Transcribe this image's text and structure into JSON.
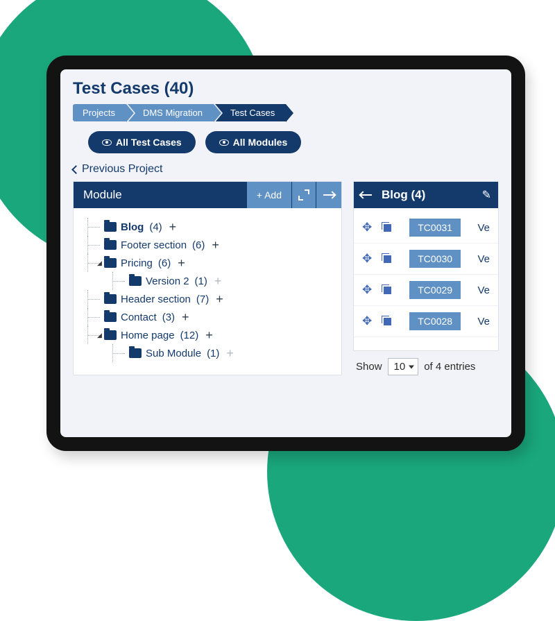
{
  "page": {
    "title": "Test Cases (40)"
  },
  "breadcrumb": {
    "items": [
      {
        "label": "Projects"
      },
      {
        "label": "DMS Migration"
      },
      {
        "label": "Test Cases"
      }
    ]
  },
  "pills": {
    "all_test_cases": "All Test Cases",
    "all_modules": "All Modules"
  },
  "nav": {
    "previous_project": "Previous Project"
  },
  "module_panel": {
    "title": "Module",
    "add_label": "+  Add",
    "tree": [
      {
        "label": "Blog",
        "count": "(4)",
        "bold": true,
        "indent": 1,
        "plusStyle": "active"
      },
      {
        "label": "Footer section",
        "count": "(6)",
        "indent": 1,
        "plusStyle": "active"
      },
      {
        "label": "Pricing",
        "count": "(6)",
        "indent": 1,
        "caret": "◢",
        "plusStyle": "active"
      },
      {
        "label": "Version 2",
        "count": "(1)",
        "indent": 2,
        "plusStyle": "muted"
      },
      {
        "label": "Header section",
        "count": "(7)",
        "indent": 1,
        "plusStyle": "active"
      },
      {
        "label": "Contact",
        "count": "(3)",
        "indent": 1,
        "plusStyle": "active"
      },
      {
        "label": "Home page",
        "count": "(12)",
        "indent": 1,
        "caret": "◢",
        "plusStyle": "active"
      },
      {
        "label": "Sub Module",
        "count": "(1)",
        "indent": 2,
        "plusStyle": "muted"
      }
    ]
  },
  "tc_panel": {
    "title": "Blog  (4)",
    "rows": [
      {
        "id": "TC0031",
        "extra": "Ve"
      },
      {
        "id": "TC0030",
        "extra": "Ve"
      },
      {
        "id": "TC0029",
        "extra": "Ve"
      },
      {
        "id": "TC0028",
        "extra": "Ve"
      }
    ],
    "pager": {
      "show": "Show",
      "value": "10",
      "of": "of 4 entries"
    }
  }
}
